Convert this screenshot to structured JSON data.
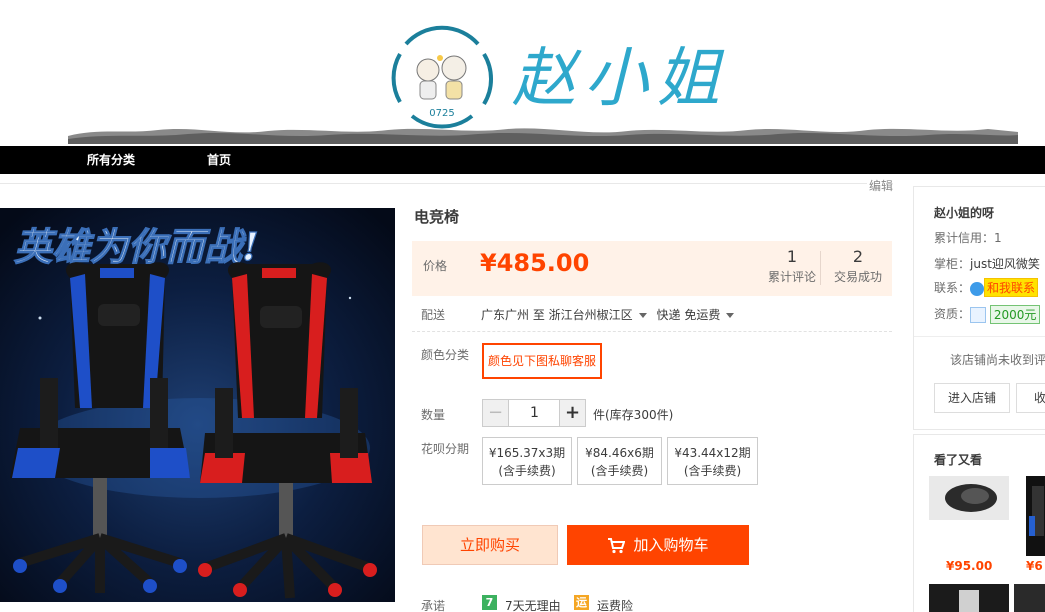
{
  "shop": {
    "logo_number": "0725",
    "logo_text": "赵小姐"
  },
  "nav": {
    "all_categories": "所有分类",
    "home": "首页",
    "edit": "编辑"
  },
  "product": {
    "image_slogan": "英雄为你而战!",
    "title": "电竞椅",
    "price_label": "价格",
    "price": "¥485.00",
    "reviews_count": "1",
    "reviews_label": "累计评论",
    "sales_count": "2",
    "sales_label": "交易成功",
    "shipping_label": "配送",
    "ship_from": "广东广州 至",
    "ship_to": "浙江台州椒江区",
    "shipping_method": "快递 免运费",
    "color_label": "颜色分类",
    "color_option": "颜色见下图私聊客服",
    "qty_label": "数量",
    "qty_minus": "−",
    "qty_value": "1",
    "qty_plus": "+",
    "stock": "件(库存300件)",
    "installment_label": "花呗分期",
    "installments": [
      {
        "amount": "¥165.37x3期",
        "note": "(含手续费)"
      },
      {
        "amount": "¥84.46x6期",
        "note": "(含手续费)"
      },
      {
        "amount": "¥43.44x12期",
        "note": "(含手续费)"
      }
    ],
    "buy_now": "立即购买",
    "add_to_cart": "加入购物车",
    "promise_label": "承诺",
    "promise_7day_badge": "7",
    "promise_7day": "7天无理由",
    "promise_freight_badge": "运",
    "promise_freight": "运费险"
  },
  "seller": {
    "name": "赵小姐的呀",
    "credit": "累计信用：1",
    "keeper_label": "掌柜：",
    "keeper": "just迎风微笑",
    "contact_label": "联系：",
    "contact_button": "和我联系",
    "qualification_label": "资质：",
    "deposit": "2000元",
    "no_review": "该店铺尚未收到评",
    "enter_shop": "进入店铺",
    "favorite_shop": "收藏"
  },
  "also_viewed": {
    "title": "看了又看",
    "items": [
      {
        "price": "¥95.00"
      },
      {
        "price": "¥6"
      }
    ]
  },
  "colors": {
    "accent": "#ff4400",
    "price_bg": "#fff2e8",
    "navbar": "#000000"
  }
}
